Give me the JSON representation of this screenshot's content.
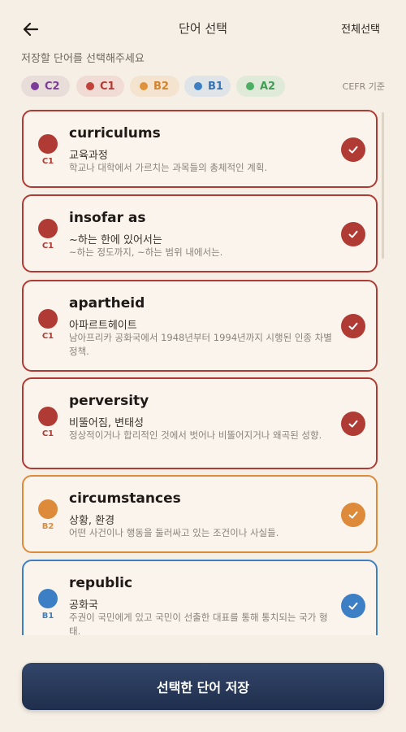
{
  "header": {
    "title": "단어 선택",
    "select_all": "전체선택",
    "back_icon": "arrow-left-icon"
  },
  "subtitle": "저장할 단어를 선택해주세요",
  "filters": {
    "chips": [
      {
        "label": "C2",
        "color": "#7b3d99",
        "bg": "#e9ddd9",
        "text_color": "#7b3d99"
      },
      {
        "label": "C1",
        "color": "#c0423b",
        "bg": "#f0dcd4",
        "text_color": "#b23a34"
      },
      {
        "label": "B2",
        "color": "#e0913b",
        "bg": "#f3e3cf",
        "text_color": "#d4832d"
      },
      {
        "label": "B1",
        "color": "#3d7fc4",
        "bg": "#dee4e8",
        "text_color": "#3573b5"
      },
      {
        "label": "A2",
        "color": "#4caf64",
        "bg": "#e0ead8",
        "text_color": "#3f9e56"
      }
    ],
    "note": "CEFR 기준"
  },
  "words": [
    {
      "level": "C1",
      "color": "#b03a34",
      "word": "curriculums",
      "meaning": "교육과정",
      "desc": "학교나 대학에서 가르치는 과목들의 총체적인 계획.",
      "selected": true
    },
    {
      "level": "C1",
      "color": "#b03a34",
      "word": "insofar as",
      "meaning": "~하는 한에 있어서는",
      "desc": "~하는 정도까지, ~하는 범위 내에서는.",
      "selected": true
    },
    {
      "level": "C1",
      "color": "#b03a34",
      "word": "apartheid",
      "meaning": "아파르트헤이트",
      "desc": "남아프리카 공화국에서 1948년부터 1994년까지 시행된 인종 차별 정책.",
      "selected": true
    },
    {
      "level": "C1",
      "color": "#b03a34",
      "word": "perversity",
      "meaning": "비뚤어짐, 변태성",
      "desc": "정상적이거나 합리적인 것에서 벗어나 비뚤어지거나 왜곡된 성향.",
      "selected": true
    },
    {
      "level": "B2",
      "color": "#dd8a3a",
      "word": "circumstances",
      "meaning": "상황, 환경",
      "desc": "어떤 사건이나 행동을 둘러싸고 있는 조건이나 사실들.",
      "selected": true
    },
    {
      "level": "B1",
      "color": "#3d7fc4",
      "word": "republic",
      "meaning": "공화국",
      "desc": "주권이 국민에게 있고 국민이 선출한 대표를 통해 통치되는 국가 형태.",
      "selected": true
    }
  ],
  "save_button": "선택한 단어 저장"
}
